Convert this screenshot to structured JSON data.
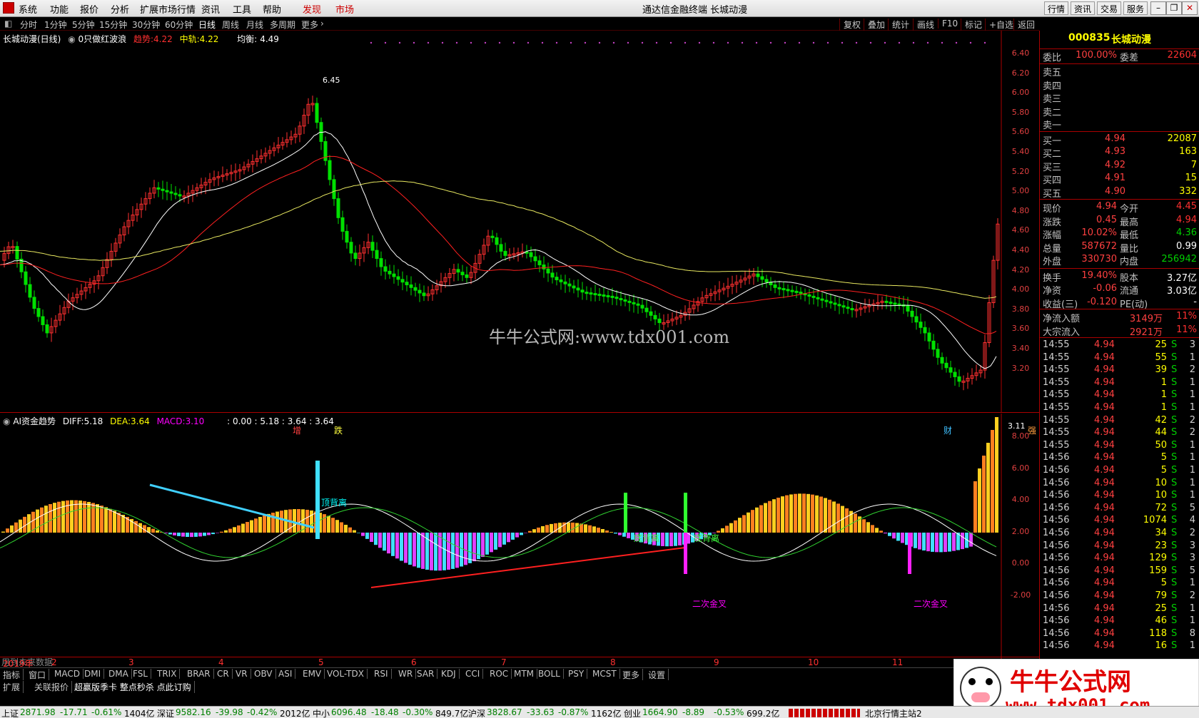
{
  "window": {
    "title": "通达信金融终端 长城动漫",
    "menu": [
      "系统",
      "功能",
      "报价",
      "分析",
      "扩展市场行情",
      "资讯",
      "工具",
      "帮助"
    ],
    "hl_menu": [
      "发现",
      "市场"
    ],
    "right_buttons": [
      "行情",
      "资讯",
      "交易",
      "服务"
    ]
  },
  "toolbar": {
    "periods": [
      "分时",
      "1分钟",
      "5分钟",
      "15分钟",
      "30分钟",
      "60分钟",
      "日线",
      "周线",
      "月线",
      "多周期",
      "更多"
    ],
    "active": "日线",
    "right": [
      "复权",
      "叠加",
      "统计",
      "画线",
      "F10",
      "标记",
      "+自选",
      "返回"
    ]
  },
  "kchart": {
    "header_name": "长城动漫(日线)",
    "indicator": "0只做红波浪",
    "trend_label": "趋势:",
    "trend_val": "4.22",
    "mid_label": "中轨:",
    "mid_val": "4.22",
    "bal_label": "均衡:",
    "bal_val": "4.49",
    "high_mark": "6.45",
    "low_mark": "3.11",
    "watermark": "牛牛公式网:www.tdx001.com",
    "signals": [
      "增",
      "跌",
      "财",
      "强"
    ],
    "axis": [
      "6.40",
      "6.20",
      "6.00",
      "5.80",
      "5.60",
      "5.40",
      "5.20",
      "5.00",
      "4.80",
      "4.60",
      "4.40",
      "4.20",
      "4.00",
      "3.80",
      "3.60",
      "3.40",
      "3.20"
    ]
  },
  "macd": {
    "name": "AI资金趋势",
    "diff_label": "DIFF:",
    "diff": "5.18",
    "dea_label": "DEA:",
    "dea": "3.64",
    "macd_label": "MACD:",
    "macd": "3.10",
    "extra": ": 0.00 : 5.18 : 3.64 : 3.64",
    "axis": [
      "8.00",
      "6.00",
      "4.00",
      "2.00",
      "0.00",
      "-2.00"
    ],
    "labels": {
      "top_div": "顶背离",
      "bot_div1": "底背离",
      "bot_div2": "底背离",
      "gold1": "二次金叉",
      "gold2": "二次金叉"
    },
    "future": "用到未来数据"
  },
  "months": [
    "2019年",
    "2",
    "3",
    "4",
    "5",
    "6",
    "7",
    "8",
    "9",
    "10",
    "11"
  ],
  "tabs1": [
    "指标",
    "窗口",
    "MACD",
    "DMI",
    "DMA",
    "FSL",
    "TRIX",
    "BRAR",
    "CR",
    "VR",
    "OBV",
    "ASI",
    "EMV",
    "VOL-TDX",
    "RSI",
    "WR",
    "SAR",
    "KDJ",
    "CCI",
    "ROC",
    "MTM",
    "BOLL",
    "PSY",
    "MCST",
    "更多",
    "设置"
  ],
  "tabs2": [
    "扩展",
    "关联报价",
    "超赢版季卡 整点秒杀 点此订购"
  ],
  "quote": {
    "code": "000835",
    "name": "长城动漫",
    "weibi_label": "委比",
    "weibi": "100.00%",
    "weicha_label": "委差",
    "weicha": "22604",
    "sells": [
      "卖五",
      "卖四",
      "卖三",
      "卖二",
      "卖一"
    ],
    "buys": [
      {
        "l": "买一",
        "p": "4.94",
        "v": "22087"
      },
      {
        "l": "买二",
        "p": "4.93",
        "v": "163"
      },
      {
        "l": "买三",
        "p": "4.92",
        "v": "7"
      },
      {
        "l": "买四",
        "p": "4.91",
        "v": "15"
      },
      {
        "l": "买五",
        "p": "4.90",
        "v": "332"
      }
    ],
    "stats": [
      {
        "l1": "现价",
        "v1": "4.94",
        "l2": "今开",
        "v2": "4.45",
        "c2": "up"
      },
      {
        "l1": "涨跌",
        "v1": "0.45",
        "l2": "最高",
        "v2": "4.94",
        "c2": "up"
      },
      {
        "l1": "涨幅",
        "v1": "10.02%",
        "l2": "最低",
        "v2": "4.36",
        "c2": "dn"
      },
      {
        "l1": "总量",
        "v1": "587672",
        "l2": "量比",
        "v2": "0.99",
        "c2": "wh"
      },
      {
        "l1": "外盘",
        "v1": "330730",
        "l2": "内盘",
        "v2": "256942",
        "c2": "dn"
      }
    ],
    "stats2": [
      {
        "l1": "换手",
        "v1": "19.40%",
        "l2": "股本",
        "v2": "3.27亿"
      },
      {
        "l1": "净资",
        "v1": "-0.06",
        "l2": "流通",
        "v2": "3.03亿"
      },
      {
        "l1": "收益(三)",
        "v1": "-0.120",
        "l2": "PE(动)",
        "v2": "-"
      }
    ],
    "flows": [
      {
        "l": "净流入额",
        "v": "3149万",
        "p": "11%"
      },
      {
        "l": "大宗流入",
        "v": "2921万",
        "p": "11%"
      }
    ],
    "ticks": [
      [
        "14:55",
        "4.94",
        "25",
        "S",
        "3"
      ],
      [
        "14:55",
        "4.94",
        "55",
        "S",
        "1"
      ],
      [
        "14:55",
        "4.94",
        "39",
        "S",
        "2"
      ],
      [
        "14:55",
        "4.94",
        "1",
        "S",
        "1"
      ],
      [
        "14:55",
        "4.94",
        "1",
        "S",
        "1"
      ],
      [
        "14:55",
        "4.94",
        "1",
        "S",
        "1"
      ],
      [
        "14:55",
        "4.94",
        "42",
        "S",
        "2"
      ],
      [
        "14:55",
        "4.94",
        "44",
        "S",
        "2"
      ],
      [
        "14:55",
        "4.94",
        "50",
        "S",
        "1"
      ],
      [
        "14:56",
        "4.94",
        "5",
        "S",
        "1"
      ],
      [
        "14:56",
        "4.94",
        "5",
        "S",
        "1"
      ],
      [
        "14:56",
        "4.94",
        "10",
        "S",
        "1"
      ],
      [
        "14:56",
        "4.94",
        "10",
        "S",
        "1"
      ],
      [
        "14:56",
        "4.94",
        "72",
        "S",
        "5"
      ],
      [
        "14:56",
        "4.94",
        "1074",
        "S",
        "4"
      ],
      [
        "14:56",
        "4.94",
        "34",
        "S",
        "2"
      ],
      [
        "14:56",
        "4.94",
        "23",
        "S",
        "3"
      ],
      [
        "14:56",
        "4.94",
        "129",
        "S",
        "3"
      ],
      [
        "14:56",
        "4.94",
        "159",
        "S",
        "5"
      ],
      [
        "14:56",
        "4.94",
        "5",
        "S",
        "1"
      ],
      [
        "14:56",
        "4.94",
        "79",
        "S",
        "2"
      ],
      [
        "14:56",
        "4.94",
        "25",
        "S",
        "1"
      ],
      [
        "14:56",
        "4.94",
        "46",
        "S",
        "1"
      ],
      [
        "14:56",
        "4.94",
        "118",
        "S",
        "8"
      ],
      [
        "14:56",
        "4.94",
        "16",
        "S",
        "1"
      ]
    ]
  },
  "status": [
    {
      "n": "上证",
      "v": "2871.98",
      "c": "-17.71",
      "p": "-0.61%",
      "a": "1404亿"
    },
    {
      "n": "深证",
      "v": "9582.16",
      "c": "-39.98",
      "p": "-0.42%",
      "a": "2012亿"
    },
    {
      "n": "中小",
      "v": "6096.48",
      "c": "-18.48",
      "p": "-0.30%",
      "a": "849.7亿"
    },
    {
      "n": "沪深",
      "v": "3828.67",
      "c": "-33.63",
      "p": "-0.87%",
      "a": "1162亿"
    },
    {
      "n": "创业",
      "v": "1664.90",
      "c": "-8.89",
      "p": "-0.53%",
      "a": "699.2亿"
    }
  ],
  "status_right": "北京行情主站2",
  "brand": {
    "title": "牛牛公式网",
    "url": "www.tdx001.com"
  }
}
